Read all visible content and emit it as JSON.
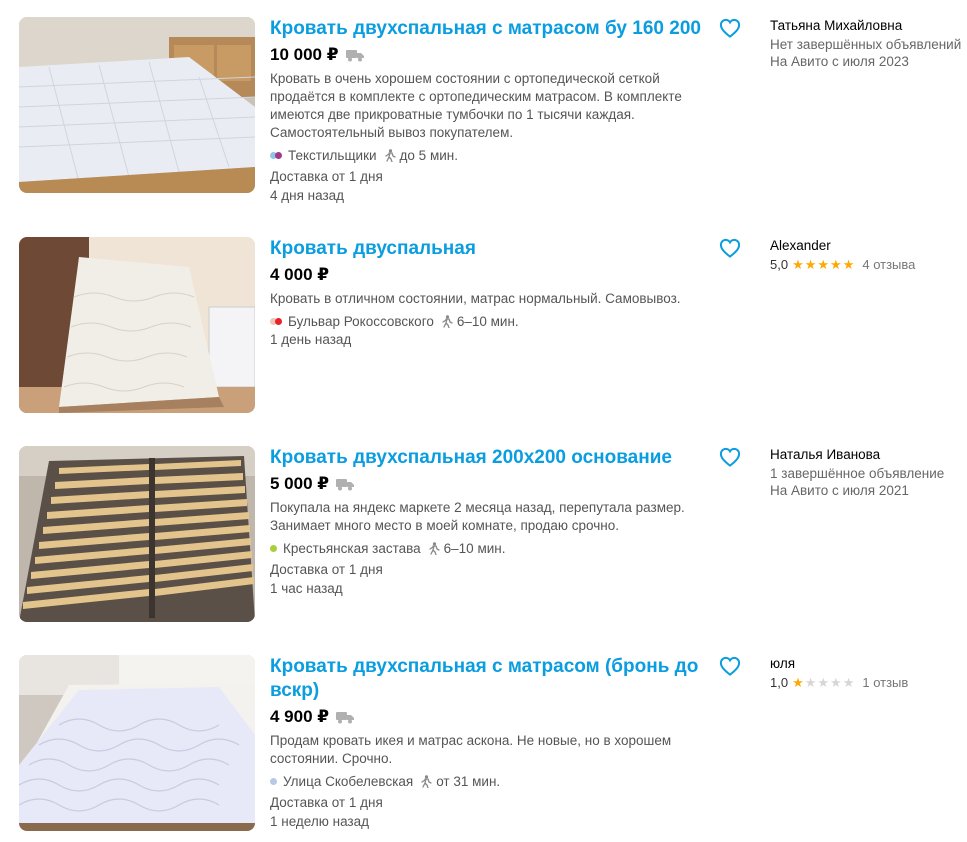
{
  "colors": {
    "title": "#0a9de0",
    "star_filled": "#ffa800",
    "star_empty": "#d6d6d6",
    "fav": "#0a9de0"
  },
  "listings": [
    {
      "title": "Кровать двухспальная с матрасом бу 160 200",
      "price": "10 000 ₽",
      "delivery_icon": true,
      "description": "Кровать в очень хорошем состоянии с ортопедической сеткой продаётся в комплекте с ортопедическим матрасом. В комплекте имеются две прикроватные тумбочки по 1 тысячи каждая. Самостоятельный вывоз покупателем.",
      "metro": {
        "station": "Текстильщики",
        "colors": [
          "#8fc6e8",
          "#9f3b88"
        ],
        "walk": "до 5 мин."
      },
      "delivery_text": "Доставка от 1 дня",
      "date": "4 дня назад",
      "seller": {
        "name": "Татьяна Михайловна",
        "line1": "Нет завершённых объявлений",
        "line2": "На Авито с июля 2023"
      }
    },
    {
      "title": "Кровать двуспальная",
      "price": "4 000 ₽",
      "delivery_icon": false,
      "description": "Кровать в отличном состоянии, матрас нормальный. Самовывоз.",
      "metro": {
        "station": "Бульвар Рокоссовского",
        "colors": [
          "#f3c2b8",
          "#e8212b"
        ],
        "walk": "6–10 мин."
      },
      "delivery_text": "",
      "date": "1 день назад",
      "seller": {
        "name": "Alexander",
        "rating": "5,0",
        "stars": 5,
        "reviews": "4 отзыва"
      }
    },
    {
      "title": "Кровать двухспальная 200х200 основание",
      "price": "5 000 ₽",
      "delivery_icon": true,
      "description": "Покупала на яндекс маркете 2 месяца назад, перепутала размер. Занимает много место в моей комнате, продаю срочно.",
      "metro": {
        "station": "Крестьянская застава",
        "colors": [
          "#a9cf3a"
        ],
        "walk": "6–10 мин."
      },
      "delivery_text": "Доставка от 1 дня",
      "date": "1 час назад",
      "seller": {
        "name": "Наталья Иванова",
        "line1": "1 завершённое объявление",
        "line2": "На Авито с июля 2021"
      }
    },
    {
      "title": "Кровать двухспальная с матрасом (бронь до вскр)",
      "price": "4 900 ₽",
      "delivery_icon": true,
      "description": "Продам кровать икея и матрас аскона. Не новые, но в хорошем состоянии. Срочно.",
      "metro": {
        "station": "Улица Скобелевская",
        "colors": [
          "#b8c8e6"
        ],
        "walk": "от 31 мин."
      },
      "delivery_text": "Доставка от 1 дня",
      "date": "1 неделю назад",
      "seller": {
        "name": "юля",
        "rating": "1,0",
        "stars": 1,
        "reviews": "1 отзыв"
      }
    }
  ]
}
